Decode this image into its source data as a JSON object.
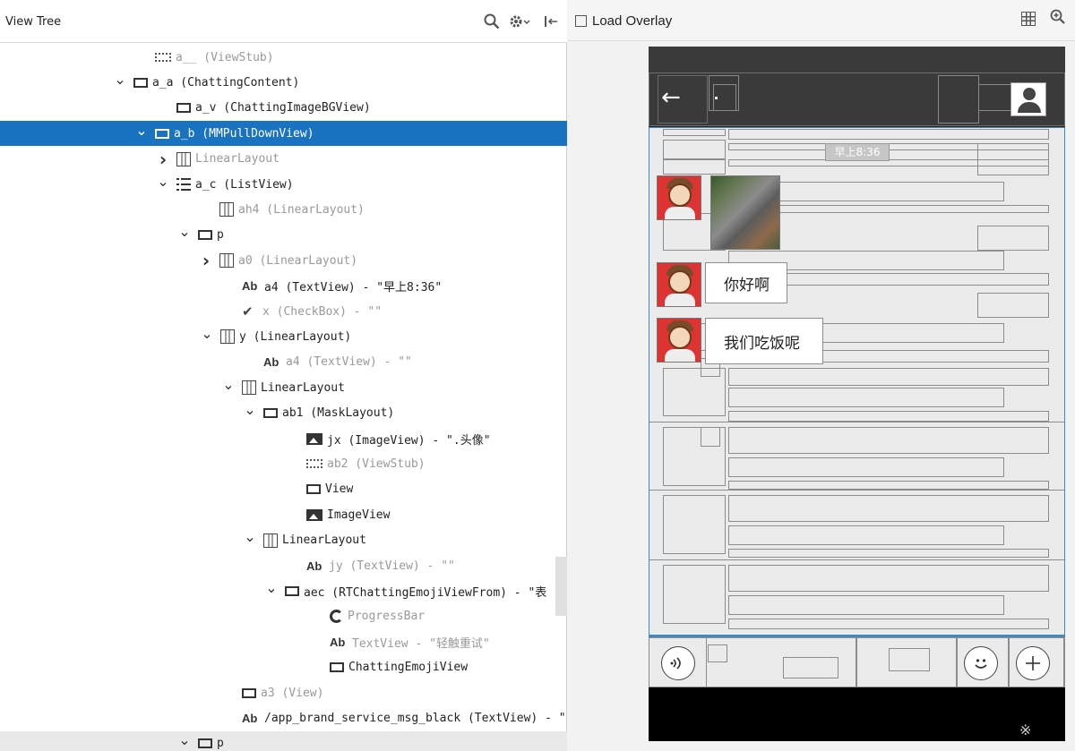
{
  "left_panel": {
    "title": "View Tree",
    "header_icons": [
      "search-icon",
      "gear-icon",
      "collapse-icon"
    ]
  },
  "tree": [
    {
      "chev": "",
      "icon": "stub",
      "text": "a__ (ViewStub)",
      "dim": true
    },
    {
      "chev": "v",
      "icon": "frame",
      "text": "a_a (ChattingContent)"
    },
    {
      "chev": "",
      "icon": "frame",
      "text": "a_v (ChattingImageBGView)"
    },
    {
      "chev": "v",
      "icon": "frame",
      "text": "a_b (MMPullDownView)",
      "selected": true
    },
    {
      "chev": ">",
      "icon": "linear",
      "text": "LinearLayout",
      "dim": true
    },
    {
      "chev": "v",
      "icon": "list",
      "text": "a_c (ListView)"
    },
    {
      "chev": "",
      "icon": "linear",
      "text": "ah4 (LinearLayout)",
      "dim": true
    },
    {
      "chev": "v",
      "icon": "frame",
      "text": "p"
    },
    {
      "chev": ">",
      "icon": "linear",
      "text": "a0 (LinearLayout)",
      "dim": true
    },
    {
      "chev": "",
      "icon": "text",
      "text": "a4 (TextView) - \"早上8:36\""
    },
    {
      "chev": "",
      "icon": "check",
      "text": "x (CheckBox) - \"\"",
      "dim": true
    },
    {
      "chev": "v",
      "icon": "linear",
      "text": "y (LinearLayout)"
    },
    {
      "chev": "",
      "icon": "text",
      "text": "a4 (TextView) - \"\"",
      "dim": true
    },
    {
      "chev": "v",
      "icon": "linear",
      "text": "LinearLayout"
    },
    {
      "chev": "v",
      "icon": "frame",
      "text": "ab1 (MaskLayout)"
    },
    {
      "chev": "",
      "icon": "image",
      "text": "jx (ImageView) - \".头像\""
    },
    {
      "chev": "",
      "icon": "stub",
      "text": "ab2 (ViewStub)",
      "dim": true
    },
    {
      "chev": "",
      "icon": "frame",
      "text": "View"
    },
    {
      "chev": "",
      "icon": "image",
      "text": "ImageView"
    },
    {
      "chev": "v",
      "icon": "linear",
      "text": "LinearLayout"
    },
    {
      "chev": "",
      "icon": "text",
      "text": "jy (TextView) - \"\"",
      "dim": true
    },
    {
      "chev": "v",
      "icon": "frame",
      "text": "aec (RTChattingEmojiViewFrom) - \"表"
    },
    {
      "chev": "",
      "icon": "progress",
      "text": "ProgressBar",
      "dim": true
    },
    {
      "chev": "",
      "icon": "text",
      "text": "TextView - \"轻触重试\"",
      "dim": true
    },
    {
      "chev": "",
      "icon": "frame",
      "text": "ChattingEmojiView"
    },
    {
      "chev": "",
      "icon": "frame",
      "text": "a3 (View)",
      "dim": true
    },
    {
      "chev": "",
      "icon": "text",
      "text": "/app_brand_service_msg_black (TextView) - \""
    },
    {
      "chev": "v",
      "icon": "frame",
      "text": "p",
      "faded": true
    }
  ],
  "right_panel": {
    "load_overlay_label": "Load Overlay",
    "header_icons": [
      "grid-icon",
      "zoom-in-icon"
    ]
  },
  "device": {
    "time_label": "早上8:36",
    "messages": [
      "你好啊",
      "我们吃饭呢"
    ],
    "watermark": "※"
  },
  "colors": {
    "selection": "#1a73c0",
    "overlay_border": "#3b8ad0",
    "action_bar": "#3a3a3a"
  }
}
